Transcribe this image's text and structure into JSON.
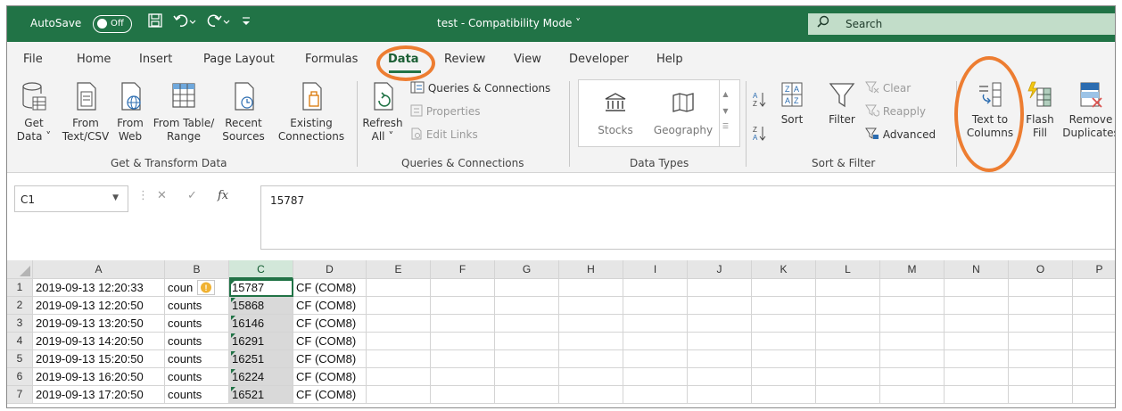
{
  "title_bar": {
    "autosave_label": "AutoSave",
    "autosave_state": "Off",
    "document_title": "test - Compatibility Mode",
    "search_placeholder": "Search"
  },
  "tabs": [
    "File",
    "Home",
    "Insert",
    "Page Layout",
    "Formulas",
    "Data",
    "Review",
    "View",
    "Developer",
    "Help"
  ],
  "active_tab": "Data",
  "ribbon": {
    "get_transform": {
      "group_label": "Get & Transform Data",
      "get_data": [
        "Get",
        "Data ˅"
      ],
      "from_text": [
        "From",
        "Text/CSV"
      ],
      "from_web": [
        "From",
        "Web"
      ],
      "from_table": [
        "From Table/",
        "Range"
      ],
      "recent_sources": [
        "Recent",
        "Sources"
      ],
      "existing_connections": [
        "Existing",
        "Connections"
      ]
    },
    "queries": {
      "group_label": "Queries & Connections",
      "refresh_all": [
        "Refresh",
        "All ˅"
      ],
      "queries_connections": "Queries & Connections",
      "properties": "Properties",
      "edit_links": "Edit Links"
    },
    "data_types": {
      "group_label": "Data Types",
      "stocks": "Stocks",
      "geography": "Geography"
    },
    "sort_filter": {
      "group_label": "Sort & Filter",
      "sort": "Sort",
      "filter": "Filter",
      "clear": "Clear",
      "reapply": "Reapply",
      "advanced": "Advanced"
    },
    "data_tools": {
      "text_to_columns": [
        "Text to",
        "Columns"
      ],
      "flash_fill": [
        "Flash",
        "Fill"
      ],
      "remove_duplicates": [
        "Remove",
        "Duplicates"
      ]
    }
  },
  "formula_bar": {
    "name_box": "C1",
    "fx": "fx",
    "value": "15787"
  },
  "sheet": {
    "columns": [
      "A",
      "B",
      "C",
      "D",
      "E",
      "F",
      "G",
      "H",
      "I",
      "J",
      "K",
      "L",
      "M",
      "N",
      "O",
      "P"
    ],
    "rows": [
      {
        "num": "1",
        "A": "2019-09-13 12:20:33",
        "B": "coun",
        "C": "15787",
        "D": "CF (COM8)"
      },
      {
        "num": "2",
        "A": "2019-09-13 12:20:50",
        "B": "counts",
        "C": "15868",
        "D": "CF (COM8)"
      },
      {
        "num": "3",
        "A": "2019-09-13 13:20:50",
        "B": "counts",
        "C": "16146",
        "D": "CF (COM8)"
      },
      {
        "num": "4",
        "A": "2019-09-13 14:20:50",
        "B": "counts",
        "C": "16291",
        "D": "CF (COM8)"
      },
      {
        "num": "5",
        "A": "2019-09-13 15:20:50",
        "B": "counts",
        "C": "16251",
        "D": "CF (COM8)"
      },
      {
        "num": "6",
        "A": "2019-09-13 16:20:50",
        "B": "counts",
        "C": "16224",
        "D": "CF (COM8)"
      },
      {
        "num": "7",
        "A": "2019-09-13 17:20:50",
        "B": "counts",
        "C": "16521",
        "D": "CF (COM8)"
      }
    ],
    "selected_column": "C",
    "active_cell": "C1"
  },
  "colors": {
    "excel_green": "#217346",
    "annotation_orange": "#ed7d31",
    "search_bg": "#c2ddc9"
  }
}
